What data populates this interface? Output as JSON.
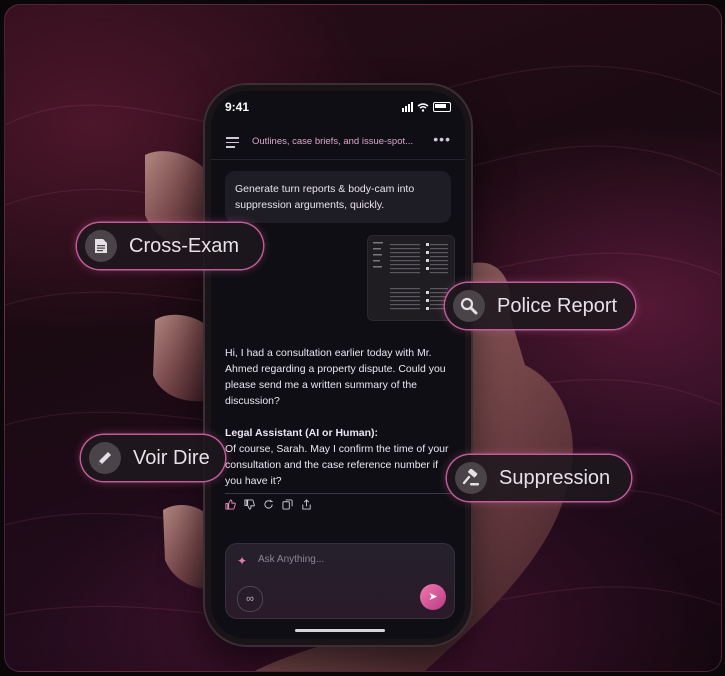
{
  "status_bar": {
    "time": "9:41"
  },
  "header": {
    "title": "Outlines, case briefs, and issue-spot...",
    "more": "•••"
  },
  "chat": {
    "prompt": "Generate turn reports & body-cam into suppression arguments, quickly.",
    "message": "Hi, I had a consultation earlier today with Mr. Ahmed regarding a property dispute. Could you please send me a written summary of the discussion?",
    "assistant_label": "Legal Assistant (AI or Human):",
    "assistant_reply": "Of course, Sarah. May I confirm the time of your consultation and the case reference number if you have it?"
  },
  "composer": {
    "placeholder": "Ask Anything...",
    "sparkle": "✦",
    "link_icon": "∞",
    "send_icon": "➤"
  },
  "chips": {
    "cross_exam": "Cross-Exam",
    "police_report": "Police Report",
    "voir_dire": "Voir Dire",
    "suppression": "Suppression"
  },
  "chip_icons": {
    "cross_exam": "document-icon",
    "police_report": "magnifier-icon",
    "voir_dire": "pencil-icon",
    "suppression": "gavel-icon"
  },
  "colors": {
    "accent": "#c25a9a",
    "send": "#e0609a",
    "background": "#1a0a12"
  }
}
